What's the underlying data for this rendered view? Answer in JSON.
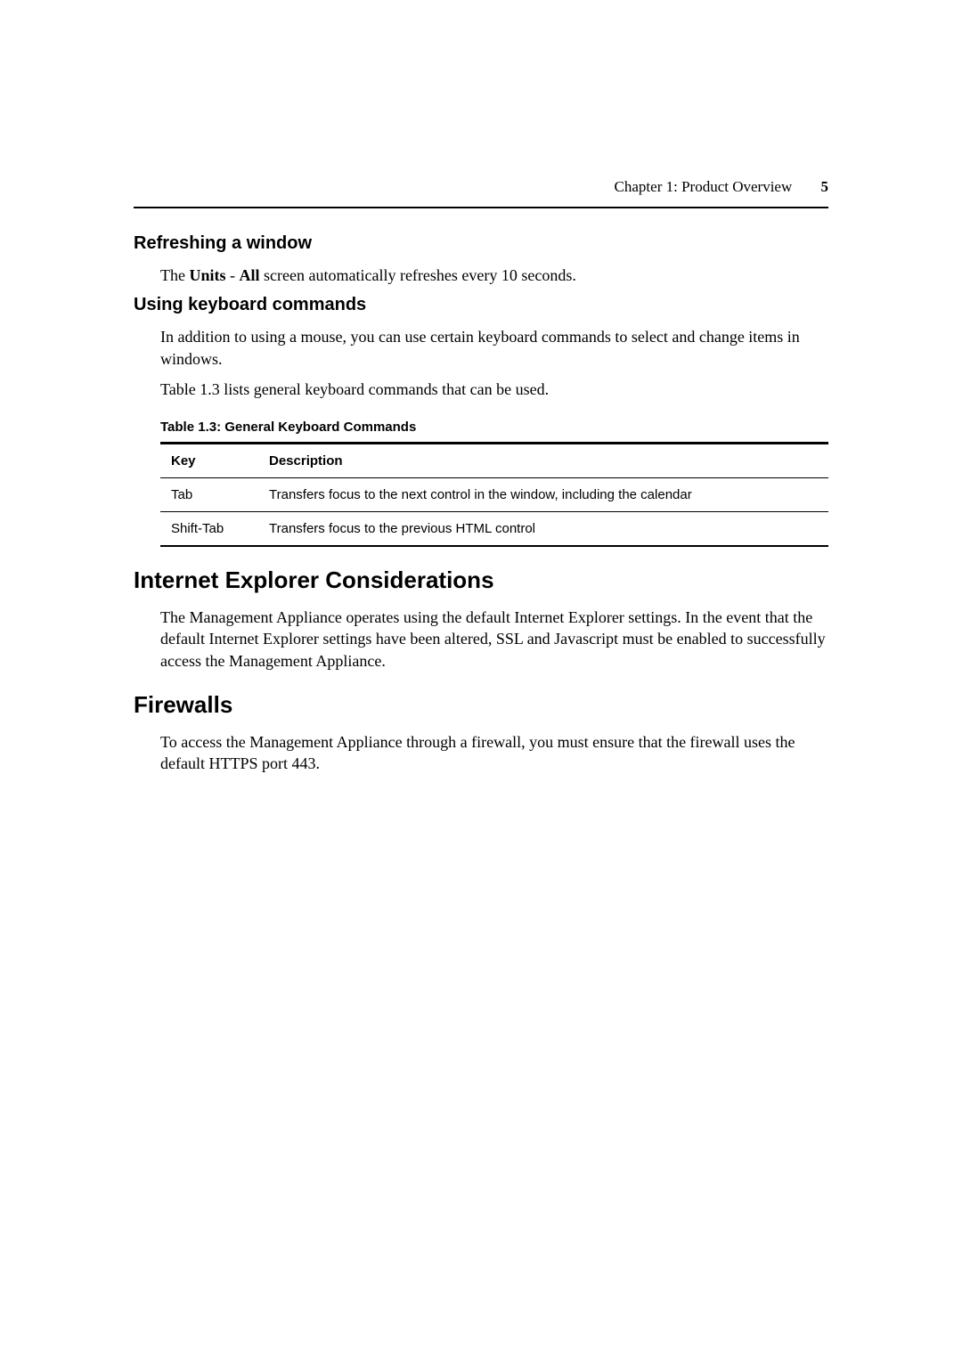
{
  "header": {
    "chapter_label": "Chapter 1: Product Overview",
    "page_number": "5"
  },
  "sections": {
    "refreshing": {
      "title": "Refreshing a window",
      "para_prefix": "The ",
      "para_bold1": "Units",
      "para_mid": " - ",
      "para_bold2": "All",
      "para_suffix": " screen automatically refreshes every 10 seconds."
    },
    "keyboard": {
      "title": "Using keyboard commands",
      "para1": "In addition to using a mouse, you can use certain keyboard commands to select and change items in windows.",
      "para2": "Table 1.3 lists general keyboard commands that can be used.",
      "table_caption": "Table 1.3: General Keyboard Commands",
      "table": {
        "headers": {
          "key": "Key",
          "desc": "Description"
        },
        "rows": [
          {
            "key": "Tab",
            "desc": "Transfers focus to the next control in the window, including the calendar"
          },
          {
            "key": "Shift-Tab",
            "desc": "Transfers focus to the previous HTML control"
          }
        ]
      }
    },
    "ie": {
      "title": "Internet Explorer Considerations",
      "para": "The Management Appliance operates using the default Internet Explorer settings. In the event that the default Internet Explorer settings have been altered, SSL and Javascript must be enabled to successfully access the Management Appliance."
    },
    "firewalls": {
      "title": "Firewalls",
      "para": "To access the Management Appliance through a firewall, you must ensure that the firewall uses the default HTTPS port 443."
    }
  }
}
